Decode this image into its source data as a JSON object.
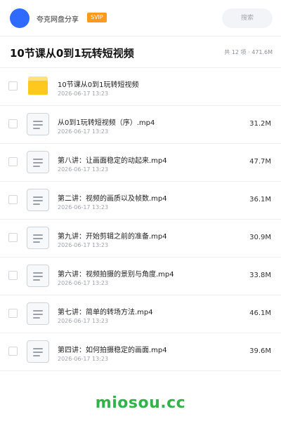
{
  "header": {
    "share_title": "夸克网盘分享",
    "vip_badge": "SVIP",
    "search_placeholder": "搜索",
    "avatar_color": "#2f6bff"
  },
  "folder": {
    "title": "10节课从0到1玩转短视频",
    "summary": "共 12 项 · 471.6M"
  },
  "files": [
    {
      "type": "folder",
      "name": "10节课从0到1玩转短视频",
      "date": "2026-06-17 13:23",
      "size": ""
    },
    {
      "type": "video",
      "name": "从0到1玩转短视频（序）.mp4",
      "date": "2026-06-17 13:23",
      "size": "31.2M"
    },
    {
      "type": "video",
      "name": "第八讲：让画面稳定的动起来.mp4",
      "date": "2026-06-17 13:23",
      "size": "47.7M"
    },
    {
      "type": "video",
      "name": "第二讲：视频的画质以及帧数.mp4",
      "date": "2026-06-17 13:23",
      "size": "36.1M"
    },
    {
      "type": "video",
      "name": "第九讲：开始剪辑之前的准备.mp4",
      "date": "2026-06-17 13:23",
      "size": "30.9M"
    },
    {
      "type": "video",
      "name": "第六讲：视频拍摄的景别与角度.mp4",
      "date": "2026-06-17 13:23",
      "size": "33.8M"
    },
    {
      "type": "video",
      "name": "第七讲：简单的转场方法.mp4",
      "date": "2026-06-17 13:23",
      "size": "46.1M"
    },
    {
      "type": "video",
      "name": "第四讲：如何拍摄稳定的画面.mp4",
      "date": "2026-06-17 13:23",
      "size": "39.6M"
    }
  ],
  "footer": {
    "watermark": "miosou.cc",
    "watermark_color": "#33b24a"
  },
  "colors": {
    "vip": "#ff9a1f",
    "folder": "#ffc81f"
  }
}
